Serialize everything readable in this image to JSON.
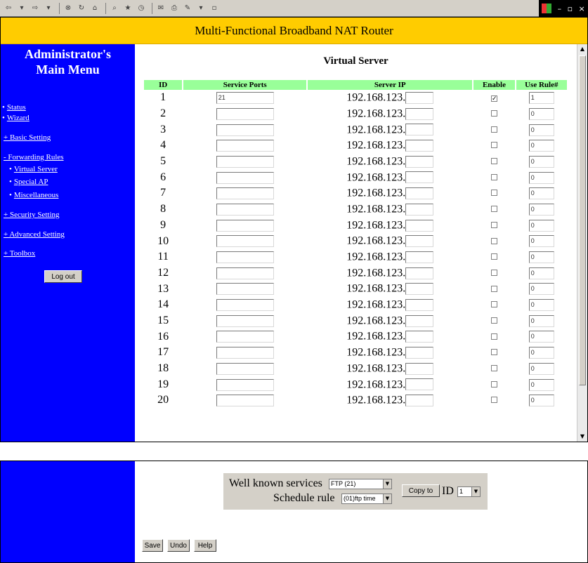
{
  "window": {
    "toolbar_icons": [
      "back-icon",
      "forward-icon",
      "stop-icon",
      "refresh-icon",
      "home-icon",
      "search-icon",
      "favorites-icon",
      "history-icon",
      "mail-icon",
      "print-icon",
      "edit-icon"
    ]
  },
  "banner": {
    "title": "Multi-Functional Broadband NAT Router"
  },
  "nav": {
    "title_line1": "Administrator's",
    "title_line2": "Main Menu",
    "items": {
      "status": "Status",
      "wizard": "Wizard",
      "basic": "+ Basic Setting",
      "forwarding": "- Forwarding Rules",
      "virtual_server": "Virtual Server",
      "special_ap": "Special AP",
      "misc": "Miscellaneous",
      "security": "+ Security Setting",
      "advanced": "+ Advanced Setting",
      "toolbox": "+ Toolbox"
    },
    "logout": "Log out"
  },
  "page": {
    "title": "Virtual Server",
    "columns": {
      "id": "ID",
      "ports": "Service Ports",
      "ip": "Server IP",
      "enable": "Enable",
      "rule": "Use Rule#"
    },
    "ip_prefix": "192.168.123.",
    "rows": [
      {
        "id": "1",
        "ports": "21",
        "ip_last": "",
        "enabled": true,
        "rule": "1"
      },
      {
        "id": "2",
        "ports": "",
        "ip_last": "",
        "enabled": false,
        "rule": "0"
      },
      {
        "id": "3",
        "ports": "",
        "ip_last": "",
        "enabled": false,
        "rule": "0"
      },
      {
        "id": "4",
        "ports": "",
        "ip_last": "",
        "enabled": false,
        "rule": "0"
      },
      {
        "id": "5",
        "ports": "",
        "ip_last": "",
        "enabled": false,
        "rule": "0"
      },
      {
        "id": "6",
        "ports": "",
        "ip_last": "",
        "enabled": false,
        "rule": "0"
      },
      {
        "id": "7",
        "ports": "",
        "ip_last": "",
        "enabled": false,
        "rule": "0"
      },
      {
        "id": "8",
        "ports": "",
        "ip_last": "",
        "enabled": false,
        "rule": "0"
      },
      {
        "id": "9",
        "ports": "",
        "ip_last": "",
        "enabled": false,
        "rule": "0"
      },
      {
        "id": "10",
        "ports": "",
        "ip_last": "",
        "enabled": false,
        "rule": "0"
      },
      {
        "id": "11",
        "ports": "",
        "ip_last": "",
        "enabled": false,
        "rule": "0"
      },
      {
        "id": "12",
        "ports": "",
        "ip_last": "",
        "enabled": false,
        "rule": "0"
      },
      {
        "id": "13",
        "ports": "",
        "ip_last": "",
        "enabled": false,
        "rule": "0"
      },
      {
        "id": "14",
        "ports": "",
        "ip_last": "",
        "enabled": false,
        "rule": "0"
      },
      {
        "id": "15",
        "ports": "",
        "ip_last": "",
        "enabled": false,
        "rule": "0"
      },
      {
        "id": "16",
        "ports": "",
        "ip_last": "",
        "enabled": false,
        "rule": "0"
      },
      {
        "id": "17",
        "ports": "",
        "ip_last": "",
        "enabled": false,
        "rule": "0"
      },
      {
        "id": "18",
        "ports": "",
        "ip_last": "",
        "enabled": false,
        "rule": "0"
      },
      {
        "id": "19",
        "ports": "",
        "ip_last": "",
        "enabled": false,
        "rule": "0"
      },
      {
        "id": "20",
        "ports": "",
        "ip_last": "",
        "enabled": false,
        "rule": "0"
      }
    ]
  },
  "bottom": {
    "well_known_label": "Well known services",
    "well_known_value": "FTP (21)",
    "schedule_label": "Schedule rule",
    "schedule_value": "(01)ftp time",
    "copy_button": "Copy to",
    "id_label": "ID",
    "id_value": "1",
    "save": "Save",
    "undo": "Undo",
    "help": "Help"
  },
  "colors": {
    "banner": "#ffcc00",
    "nav": "#0000ff",
    "table_header": "#99ff99",
    "panel": "#d4d0c8"
  }
}
